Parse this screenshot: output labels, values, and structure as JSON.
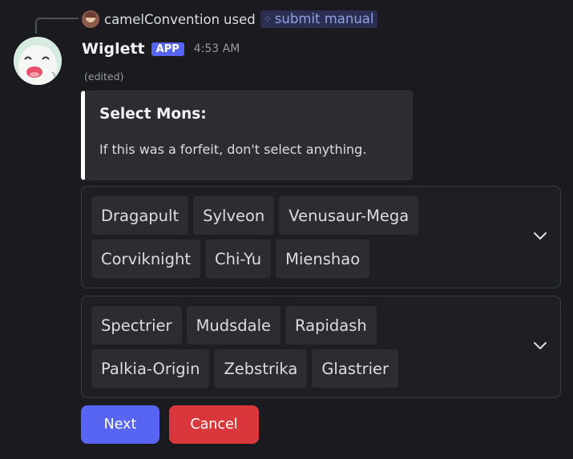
{
  "reply": {
    "username": "camelConvention",
    "used_text": "used",
    "command": "submit manual",
    "command_icon": "apps-icon"
  },
  "message": {
    "author": "Wiglett",
    "app_tag": "APP",
    "timestamp": "4:53 AM",
    "edited": "(edited)"
  },
  "embed": {
    "title": "Select Mons:",
    "description": "If this was a forfeit, don't select anything.",
    "accent_color": "#ffffff"
  },
  "select_menus": [
    {
      "rows": [
        [
          "Dragapult",
          "Sylveon",
          "Venusaur-Mega"
        ],
        [
          "Corviknight",
          "Chi-Yu",
          "Mienshao"
        ]
      ]
    },
    {
      "rows": [
        [
          "Spectrier",
          "Mudsdale",
          "Rapidash"
        ],
        [
          "Palkia-Origin",
          "Zebstrika",
          "Glastrier"
        ]
      ]
    }
  ],
  "buttons": {
    "next": "Next",
    "cancel": "Cancel"
  },
  "colors": {
    "blurple": "#5865f2",
    "danger": "#da373c",
    "background": "#1b1b1f"
  }
}
